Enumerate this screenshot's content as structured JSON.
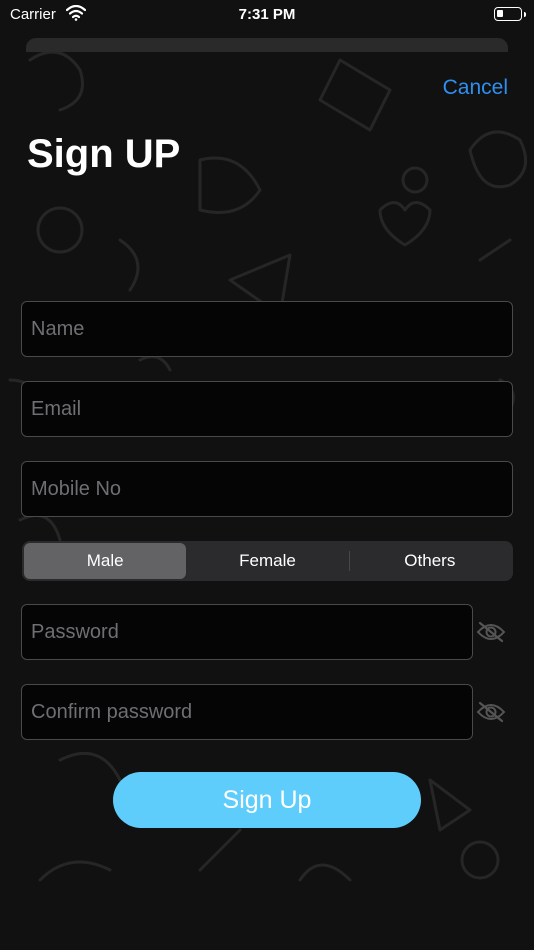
{
  "status_bar": {
    "carrier": "Carrier",
    "time": "7:31 PM"
  },
  "header": {
    "cancel_label": "Cancel",
    "title": "Sign UP"
  },
  "form": {
    "name_placeholder": "Name",
    "email_placeholder": "Email",
    "mobile_placeholder": "Mobile No",
    "password_placeholder": "Password",
    "confirm_password_placeholder": "Confirm password",
    "gender_options": [
      "Male",
      "Female",
      "Others"
    ],
    "gender_selected": "Male"
  },
  "submit_label": "Sign Up",
  "colors": {
    "accent": "#2f8ff0",
    "button": "#5fcdfb",
    "background": "#111111"
  },
  "icons": {
    "password_toggle": "eye-slash-icon",
    "wifi": "wifi-icon",
    "battery": "battery-icon"
  }
}
